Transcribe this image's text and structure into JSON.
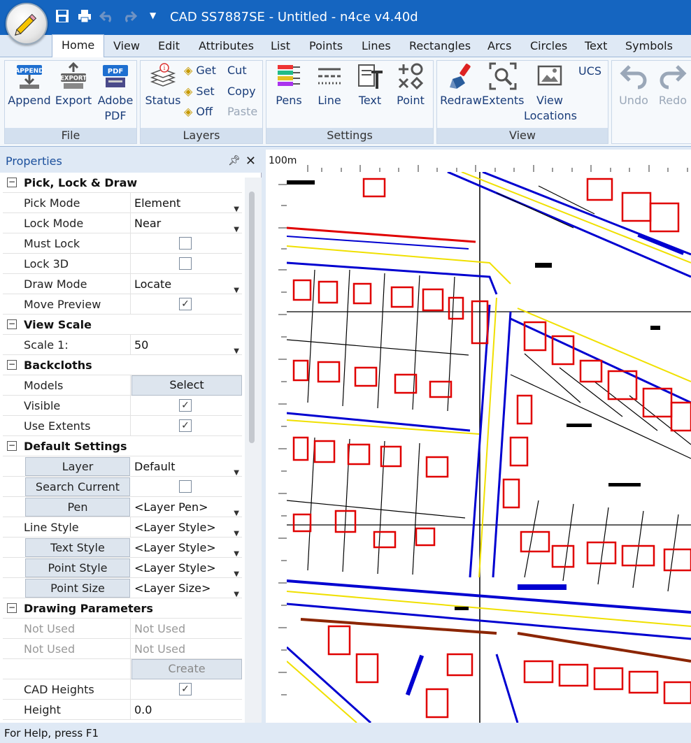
{
  "window": {
    "title": "CAD SS7887SE - Untitled - n4ce v4.40d"
  },
  "tabs": [
    "Home",
    "View",
    "Edit",
    "Attributes",
    "List",
    "Points",
    "Lines",
    "Rectangles",
    "Arcs",
    "Circles",
    "Text",
    "Symbols"
  ],
  "active_tab": "Home",
  "ribbon": {
    "file": {
      "label": "File",
      "append": "Append",
      "export": "Export",
      "pdf": "Adobe PDF",
      "append_icon_text": "APPEND",
      "export_icon_text": "EXPORT",
      "pdf_icon_text": "PDF"
    },
    "layers": {
      "label": "Layers",
      "status": "Status",
      "get": "Get",
      "set": "Set",
      "off": "Off",
      "cut": "Cut",
      "copy": "Copy",
      "paste": "Paste"
    },
    "settings": {
      "label": "Settings",
      "pens": "Pens",
      "line": "Line",
      "text": "Text",
      "point": "Point"
    },
    "view": {
      "label": "View",
      "redraw": "Redraw",
      "extents": "Extents",
      "view_locations": "View Locations",
      "ucs": "UCS"
    },
    "history": {
      "undo": "Undo",
      "redo": "Redo"
    }
  },
  "properties": {
    "title": "Properties",
    "pick_lock_draw": {
      "header": "Pick, Lock & Draw",
      "pick_mode_label": "Pick Mode",
      "pick_mode": "Element",
      "lock_mode_label": "Lock Mode",
      "lock_mode": "Near",
      "must_lock_label": "Must Lock",
      "must_lock": false,
      "lock_3d_label": "Lock 3D",
      "lock_3d": false,
      "draw_mode_label": "Draw Mode",
      "draw_mode": "Locate",
      "move_preview_label": "Move Preview",
      "move_preview": true
    },
    "view_scale": {
      "header": "View Scale",
      "scale_label": "Scale 1:",
      "scale": "50"
    },
    "backcloths": {
      "header": "Backcloths",
      "models_label": "Models",
      "models_button": "Select",
      "visible_label": "Visible",
      "visible": true,
      "use_extents_label": "Use Extents",
      "use_extents": true
    },
    "default_settings": {
      "header": "Default Settings",
      "layer_button": "Layer",
      "layer": "Default",
      "search_current_button": "Search Current",
      "search_current": false,
      "pen_button": "Pen",
      "pen": "<Layer Pen>",
      "line_style_label": "Line Style",
      "line_style": "<Layer Style>",
      "text_style_button": "Text Style",
      "text_style": "<Layer Style>",
      "point_style_button": "Point Style",
      "point_style": "<Layer Style>",
      "point_size_button": "Point Size",
      "point_size": "<Layer Size>"
    },
    "drawing_parameters": {
      "header": "Drawing Parameters",
      "not_used_1_label": "Not Used",
      "not_used_1": "Not Used",
      "not_used_2_label": "Not Used",
      "not_used_2": "Not Used",
      "create_button": "Create",
      "cad_heights_label": "CAD Heights",
      "cad_heights": true,
      "height_label": "Height",
      "height": "0.0"
    }
  },
  "canvas": {
    "scale_label": "100m"
  },
  "status": {
    "text": "For Help, press F1"
  },
  "colors": {
    "titlebar": "#1565c0",
    "building": "#e00000",
    "road_edge": "#0000d0",
    "road_center": "#f0e000"
  }
}
